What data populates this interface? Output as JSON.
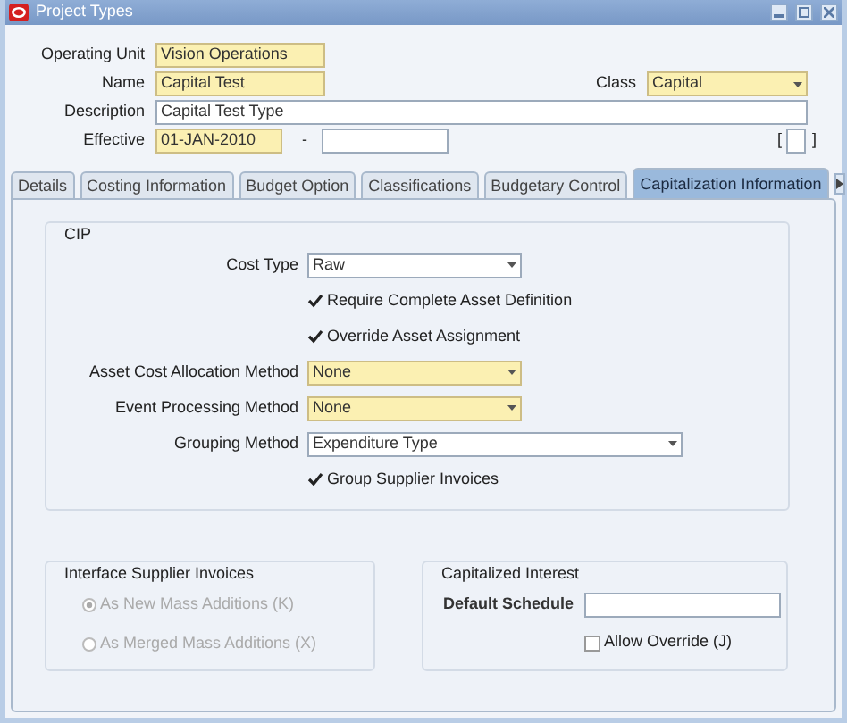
{
  "window": {
    "title": "Project Types"
  },
  "header": {
    "operating_unit": {
      "label": "Operating Unit",
      "value": "Vision Operations",
      "required": true
    },
    "name": {
      "label": "Name",
      "value": "Capital Test",
      "required": true
    },
    "class": {
      "label": "Class",
      "value": "Capital",
      "required": true
    },
    "description": {
      "label": "Description",
      "value": "Capital Test Type",
      "required": false
    },
    "effective": {
      "label": "Effective",
      "from": "01-JAN-2010",
      "separator": "-",
      "required": true
    },
    "flex_field": {
      "open": "[",
      "close": "]"
    }
  },
  "tabs": [
    {
      "label": "Details",
      "selected": false
    },
    {
      "label": "Costing Information",
      "selected": false
    },
    {
      "label": "Budget Option",
      "selected": false
    },
    {
      "label": "Classifications",
      "selected": false
    },
    {
      "label": "Budgetary Control",
      "selected": false
    },
    {
      "label": "Capitalization Information",
      "selected": true
    }
  ],
  "cip": {
    "title": "CIP",
    "rows": [
      {
        "kind": "select",
        "label": "Cost Type",
        "value": "Raw",
        "required": false
      },
      {
        "kind": "checkbox",
        "label": "Require Complete Asset Definition",
        "checked": true
      },
      {
        "kind": "checkbox",
        "label": "Override Asset Assignment",
        "checked": true
      },
      {
        "kind": "select",
        "label": "Asset Cost Allocation Method",
        "value": "None",
        "required": true
      },
      {
        "kind": "select",
        "label": "Event Processing Method",
        "value": "None",
        "required": true
      },
      {
        "kind": "wide_select",
        "label": "Grouping Method",
        "value": "Expenditure Type",
        "required": false
      },
      {
        "kind": "checkbox",
        "label": "Group Supplier Invoices",
        "checked": true
      }
    ]
  },
  "interface_supplier_invoices": {
    "title": "Interface Supplier Invoices",
    "disabled": true,
    "options": [
      {
        "label": "As New Mass Additions (K)",
        "selected": true
      },
      {
        "label": "As Merged Mass Additions (X)",
        "selected": false
      }
    ]
  },
  "capitalized_interest": {
    "title": "Capitalized Interest",
    "default_schedule_label": "Default Schedule",
    "allow_override": {
      "label": "Allow Override (J)",
      "checked": false
    }
  }
}
